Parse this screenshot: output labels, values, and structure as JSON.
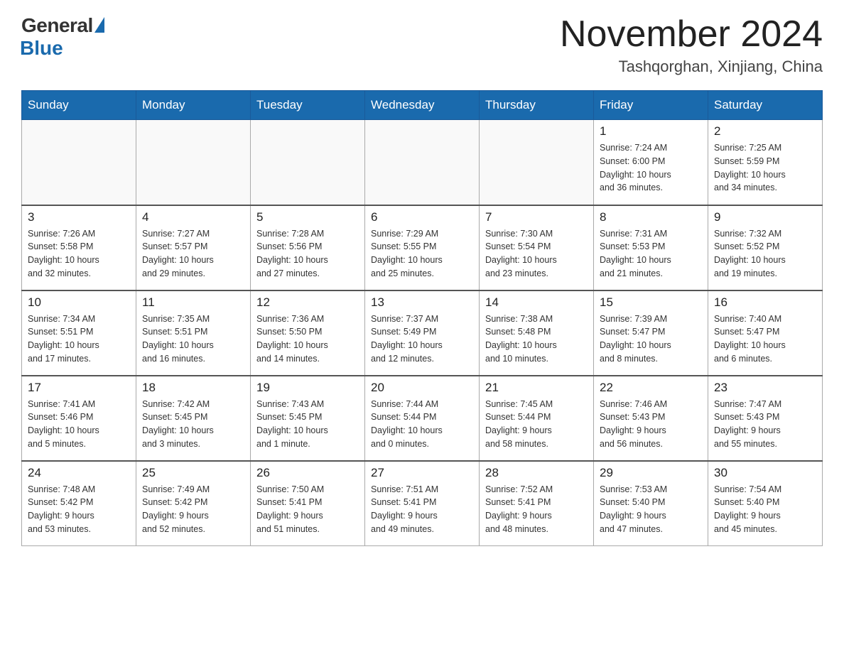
{
  "header": {
    "logo": {
      "general_text": "General",
      "blue_text": "Blue"
    },
    "title": "November 2024",
    "location": "Tashqorghan, Xinjiang, China"
  },
  "days_of_week": [
    "Sunday",
    "Monday",
    "Tuesday",
    "Wednesday",
    "Thursday",
    "Friday",
    "Saturday"
  ],
  "weeks": [
    [
      {
        "day": "",
        "info": ""
      },
      {
        "day": "",
        "info": ""
      },
      {
        "day": "",
        "info": ""
      },
      {
        "day": "",
        "info": ""
      },
      {
        "day": "",
        "info": ""
      },
      {
        "day": "1",
        "info": "Sunrise: 7:24 AM\nSunset: 6:00 PM\nDaylight: 10 hours\nand 36 minutes."
      },
      {
        "day": "2",
        "info": "Sunrise: 7:25 AM\nSunset: 5:59 PM\nDaylight: 10 hours\nand 34 minutes."
      }
    ],
    [
      {
        "day": "3",
        "info": "Sunrise: 7:26 AM\nSunset: 5:58 PM\nDaylight: 10 hours\nand 32 minutes."
      },
      {
        "day": "4",
        "info": "Sunrise: 7:27 AM\nSunset: 5:57 PM\nDaylight: 10 hours\nand 29 minutes."
      },
      {
        "day": "5",
        "info": "Sunrise: 7:28 AM\nSunset: 5:56 PM\nDaylight: 10 hours\nand 27 minutes."
      },
      {
        "day": "6",
        "info": "Sunrise: 7:29 AM\nSunset: 5:55 PM\nDaylight: 10 hours\nand 25 minutes."
      },
      {
        "day": "7",
        "info": "Sunrise: 7:30 AM\nSunset: 5:54 PM\nDaylight: 10 hours\nand 23 minutes."
      },
      {
        "day": "8",
        "info": "Sunrise: 7:31 AM\nSunset: 5:53 PM\nDaylight: 10 hours\nand 21 minutes."
      },
      {
        "day": "9",
        "info": "Sunrise: 7:32 AM\nSunset: 5:52 PM\nDaylight: 10 hours\nand 19 minutes."
      }
    ],
    [
      {
        "day": "10",
        "info": "Sunrise: 7:34 AM\nSunset: 5:51 PM\nDaylight: 10 hours\nand 17 minutes."
      },
      {
        "day": "11",
        "info": "Sunrise: 7:35 AM\nSunset: 5:51 PM\nDaylight: 10 hours\nand 16 minutes."
      },
      {
        "day": "12",
        "info": "Sunrise: 7:36 AM\nSunset: 5:50 PM\nDaylight: 10 hours\nand 14 minutes."
      },
      {
        "day": "13",
        "info": "Sunrise: 7:37 AM\nSunset: 5:49 PM\nDaylight: 10 hours\nand 12 minutes."
      },
      {
        "day": "14",
        "info": "Sunrise: 7:38 AM\nSunset: 5:48 PM\nDaylight: 10 hours\nand 10 minutes."
      },
      {
        "day": "15",
        "info": "Sunrise: 7:39 AM\nSunset: 5:47 PM\nDaylight: 10 hours\nand 8 minutes."
      },
      {
        "day": "16",
        "info": "Sunrise: 7:40 AM\nSunset: 5:47 PM\nDaylight: 10 hours\nand 6 minutes."
      }
    ],
    [
      {
        "day": "17",
        "info": "Sunrise: 7:41 AM\nSunset: 5:46 PM\nDaylight: 10 hours\nand 5 minutes."
      },
      {
        "day": "18",
        "info": "Sunrise: 7:42 AM\nSunset: 5:45 PM\nDaylight: 10 hours\nand 3 minutes."
      },
      {
        "day": "19",
        "info": "Sunrise: 7:43 AM\nSunset: 5:45 PM\nDaylight: 10 hours\nand 1 minute."
      },
      {
        "day": "20",
        "info": "Sunrise: 7:44 AM\nSunset: 5:44 PM\nDaylight: 10 hours\nand 0 minutes."
      },
      {
        "day": "21",
        "info": "Sunrise: 7:45 AM\nSunset: 5:44 PM\nDaylight: 9 hours\nand 58 minutes."
      },
      {
        "day": "22",
        "info": "Sunrise: 7:46 AM\nSunset: 5:43 PM\nDaylight: 9 hours\nand 56 minutes."
      },
      {
        "day": "23",
        "info": "Sunrise: 7:47 AM\nSunset: 5:43 PM\nDaylight: 9 hours\nand 55 minutes."
      }
    ],
    [
      {
        "day": "24",
        "info": "Sunrise: 7:48 AM\nSunset: 5:42 PM\nDaylight: 9 hours\nand 53 minutes."
      },
      {
        "day": "25",
        "info": "Sunrise: 7:49 AM\nSunset: 5:42 PM\nDaylight: 9 hours\nand 52 minutes."
      },
      {
        "day": "26",
        "info": "Sunrise: 7:50 AM\nSunset: 5:41 PM\nDaylight: 9 hours\nand 51 minutes."
      },
      {
        "day": "27",
        "info": "Sunrise: 7:51 AM\nSunset: 5:41 PM\nDaylight: 9 hours\nand 49 minutes."
      },
      {
        "day": "28",
        "info": "Sunrise: 7:52 AM\nSunset: 5:41 PM\nDaylight: 9 hours\nand 48 minutes."
      },
      {
        "day": "29",
        "info": "Sunrise: 7:53 AM\nSunset: 5:40 PM\nDaylight: 9 hours\nand 47 minutes."
      },
      {
        "day": "30",
        "info": "Sunrise: 7:54 AM\nSunset: 5:40 PM\nDaylight: 9 hours\nand 45 minutes."
      }
    ]
  ]
}
